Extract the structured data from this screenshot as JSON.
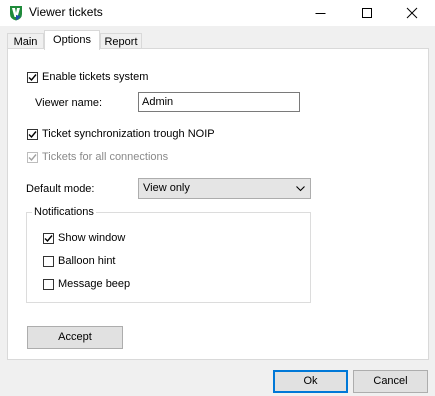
{
  "window": {
    "title": "Viewer tickets",
    "icon": "app-shield-icon",
    "controls": [
      "minimize-icon",
      "maximize-icon",
      "close-icon"
    ]
  },
  "tabs": [
    {
      "label": "Main",
      "active": false
    },
    {
      "label": "Options",
      "active": true
    },
    {
      "label": "Report",
      "active": false
    }
  ],
  "options": {
    "enable_tickets": {
      "label": "Enable tickets system",
      "checked": true,
      "enabled": true
    },
    "viewer_name": {
      "label": "Viewer name:",
      "value": "Admin"
    },
    "ticket_sync": {
      "label": "Ticket synchronization trough NOIP",
      "checked": true,
      "enabled": true
    },
    "all_connections": {
      "label": "Tickets for all connections",
      "checked": true,
      "enabled": false
    },
    "default_mode": {
      "label": "Default mode:",
      "value": "View only"
    },
    "notifications": {
      "title": "Notifications",
      "show_window": {
        "label": "Show window",
        "checked": true
      },
      "balloon_hint": {
        "label": "Balloon hint",
        "checked": false
      },
      "message_beep": {
        "label": "Message beep",
        "checked": false
      }
    },
    "accept_label": "Accept"
  },
  "footer": {
    "ok_label": "Ok",
    "cancel_label": "Cancel"
  },
  "colors": {
    "accent": "#0078d7",
    "app_icon_green": "#1f8a3a",
    "app_icon_blue": "#1e4fa8"
  }
}
